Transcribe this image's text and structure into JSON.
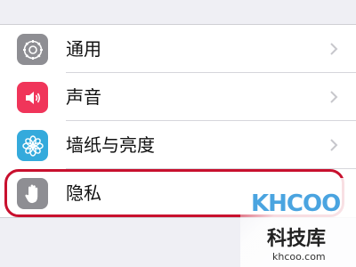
{
  "settings": {
    "items": [
      {
        "label": "通用",
        "icon": "gear-icon",
        "icon_color": "#8e8e93"
      },
      {
        "label": "声音",
        "icon": "speaker-icon",
        "icon_color": "#f0355a"
      },
      {
        "label": "墙纸与亮度",
        "icon": "flower-icon",
        "icon_color": "#34aadc"
      },
      {
        "label": "隐私",
        "icon": "hand-icon",
        "icon_color": "#8e8e93"
      }
    ]
  },
  "highlight_color": "#c8102e",
  "watermark": {
    "logo": "KHCOO",
    "name": "科技库",
    "url": "khcoo.com"
  }
}
